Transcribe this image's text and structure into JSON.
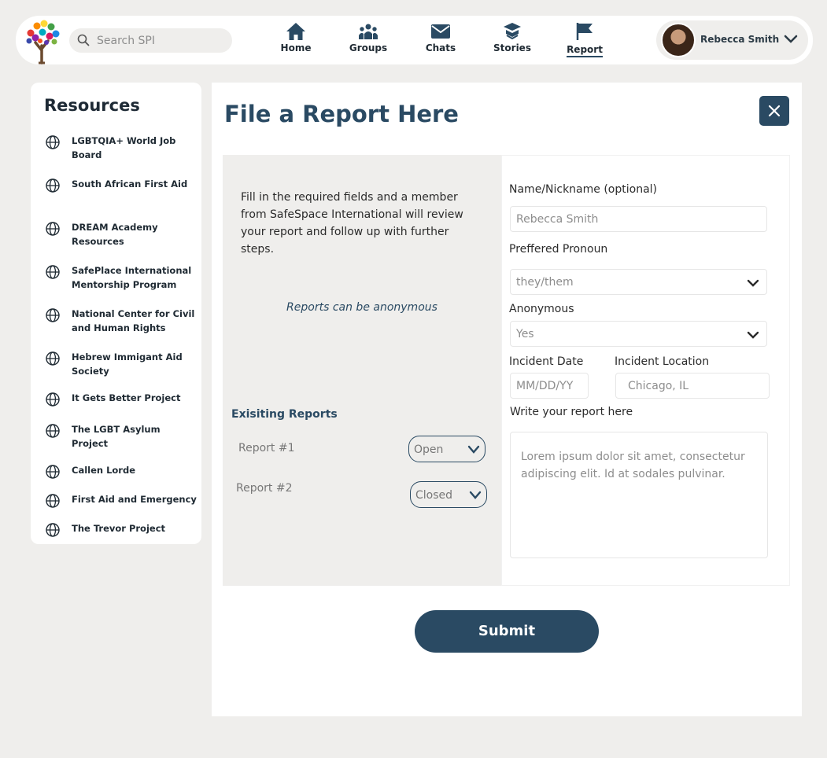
{
  "nav": {
    "search_placeholder": "Search SPI",
    "items": [
      {
        "label": "Home",
        "icon": "home-icon"
      },
      {
        "label": "Groups",
        "icon": "groups-icon"
      },
      {
        "label": "Chats",
        "icon": "mail-icon"
      },
      {
        "label": "Stories",
        "icon": "stories-icon"
      },
      {
        "label": "Report",
        "icon": "flag-icon",
        "active": true
      }
    ],
    "user_name": "Rebecca Smith"
  },
  "sidebar": {
    "title": "Resources",
    "items": [
      {
        "label": "LGBTQIA+ World Job Board"
      },
      {
        "label": "South African First Aid"
      },
      {
        "label": "DREAM Academy Resources"
      },
      {
        "label": "SafePlace International Mentorship Program"
      },
      {
        "label": "National Center for Civil and Human Rights"
      },
      {
        "label": "Hebrew Immigant Aid Society"
      },
      {
        "label": "It Gets Better Project"
      },
      {
        "label": "The LGBT Asylum Project"
      },
      {
        "label": "Callen Lorde"
      },
      {
        "label": "First Aid and Emergency"
      },
      {
        "label": "The Trevor Project"
      }
    ]
  },
  "main": {
    "title": "File a Report Here",
    "intro": "Fill in the required fields and a member from SafeSpace International will review your report and follow up with further steps.",
    "anon_note": "Reports can be anonymous",
    "existing_title": "Exisiting Reports",
    "reports": [
      {
        "name": "Report #1",
        "status": "Open"
      },
      {
        "name": "Report #2",
        "status": "Closed"
      }
    ],
    "form": {
      "name_label": "Name/Nickname (optional)",
      "name_value": "Rebecca Smith",
      "pronoun_label": "Preffered Pronoun",
      "pronoun_value": "they/them",
      "anonymous_label": "Anonymous",
      "anonymous_value": "Yes",
      "date_label": "Incident Date",
      "date_placeholder": "MM/DD/YY",
      "location_label": "Incident Location",
      "location_placeholder": "Chicago, IL",
      "report_label": "Write your report here",
      "report_placeholder": "Lorem ipsum dolor sit amet, consectetur adipiscing elit. Id at sodales pulvinar."
    },
    "submit_label": "Submit"
  },
  "colors": {
    "primary": "#2a4a63",
    "background": "#efeeec",
    "panel": "#ffffff"
  }
}
